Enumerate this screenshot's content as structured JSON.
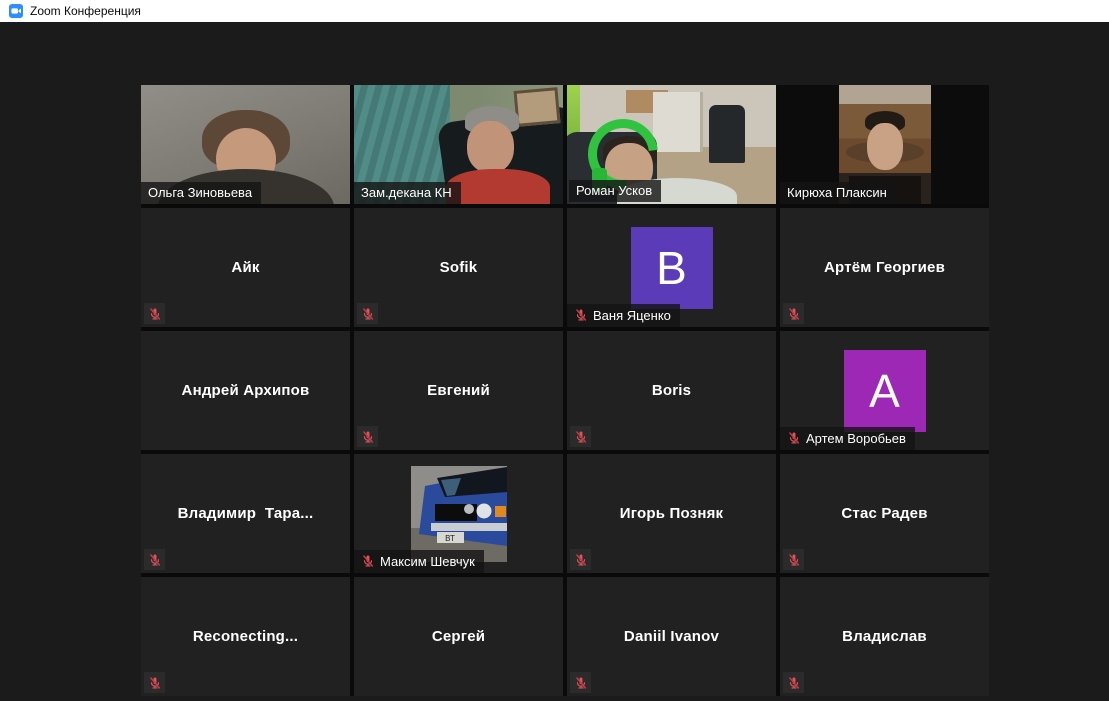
{
  "window": {
    "title": "Zoom Конференция"
  },
  "colors": {
    "titlebar_bg": "#ffffff",
    "zoom_brand_blue": "#2d8cff",
    "page_bg": "#1b1b1b",
    "grid_gap": "#0a0a0a",
    "tile_bg": "#212121",
    "active_speaker_border": "#d8e24b",
    "muted_mic_red": "#e0535c",
    "name_text": "#ffffff"
  },
  "gallery": {
    "columns": 4,
    "rows": 5,
    "participant_count": 20
  },
  "participants": [
    {
      "name": "Ольга Зиновьева",
      "type": "video",
      "scene": "olga",
      "muted": false,
      "active": false
    },
    {
      "name": "Зам.декана КН",
      "type": "video",
      "scene": "dean",
      "muted": false,
      "active": false
    },
    {
      "name": "Роман Усков",
      "type": "video",
      "scene": "roman",
      "muted": false,
      "active": true
    },
    {
      "name": "Кирюха Плаксин",
      "type": "video",
      "scene": "kiryuha",
      "muted": false,
      "active": false
    },
    {
      "name": "Айк",
      "type": "name",
      "muted": true
    },
    {
      "name": "Sofik",
      "type": "name",
      "muted": true
    },
    {
      "name": "Ваня Яценко",
      "type": "avatar",
      "avatar_letter": "В",
      "avatar_color": "#5b3bb8",
      "muted": true
    },
    {
      "name": "Артём Георгиев",
      "type": "name",
      "muted": true
    },
    {
      "name": "Андрей Архипов",
      "type": "name",
      "muted": false
    },
    {
      "name": "Евгений",
      "type": "name",
      "muted": true
    },
    {
      "name": "Boris",
      "type": "name",
      "muted": true
    },
    {
      "name": "Артем Воробьев",
      "type": "avatar",
      "avatar_letter": "А",
      "avatar_color": "#9d28b5",
      "muted": true
    },
    {
      "name": "Владимир  Тара...",
      "type": "name",
      "muted": true
    },
    {
      "name": "Максим Шевчук",
      "type": "avatar",
      "avatar_image": "car",
      "muted": true
    },
    {
      "name": "Игорь Позняк",
      "type": "name",
      "muted": true
    },
    {
      "name": "Стас Радев",
      "type": "name",
      "muted": true
    },
    {
      "name": "Reconecting...",
      "type": "name",
      "muted": true
    },
    {
      "name": "Сергей",
      "type": "name",
      "muted": false
    },
    {
      "name": "Daniil Ivanov",
      "type": "name",
      "muted": true
    },
    {
      "name": "Владислав",
      "type": "name",
      "muted": true
    }
  ]
}
